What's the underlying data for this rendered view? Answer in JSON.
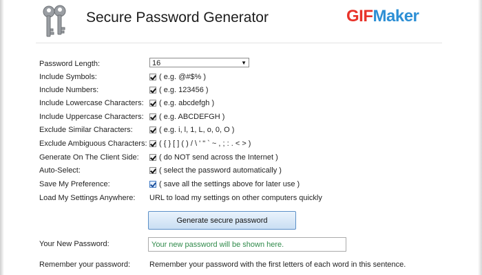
{
  "header": {
    "title": "Secure Password Generator",
    "brand_part1": "GIF",
    "brand_part2": "Maker",
    "logo_icon": "keys-icon"
  },
  "colors": {
    "brand_red": "#e8332a",
    "brand_blue": "#2d8fd5",
    "placeholder_green": "#2f8a4a",
    "button_border": "#5b8fc7"
  },
  "form": {
    "password_length": {
      "label": "Password Length:",
      "selected": "16"
    },
    "include_symbols": {
      "label": "Include Symbols:",
      "hint": "( e.g. @#$% )",
      "checked": true
    },
    "include_numbers": {
      "label": "Include Numbers:",
      "hint": "( e.g. 123456 )",
      "checked": true
    },
    "include_lowercase": {
      "label": "Include Lowercase Characters:",
      "hint": "( e.g. abcdefgh )",
      "checked": true
    },
    "include_uppercase": {
      "label": "Include Uppercase Characters:",
      "hint": "( e.g. ABCDEFGH )",
      "checked": true
    },
    "exclude_similar": {
      "label": "Exclude Similar Characters:",
      "hint": "( e.g. i, l, 1, L, o, 0, O )",
      "checked": true
    },
    "exclude_ambiguous": {
      "label": "Exclude Ambiguous Characters:",
      "hint": "( { } [ ] ( ) / \\ ' \" ` ~ , ; : . < > )",
      "checked": true
    },
    "generate_client_side": {
      "label": "Generate On The Client Side:",
      "hint": "( do NOT send across the Internet )",
      "checked": true
    },
    "auto_select": {
      "label": "Auto-Select:",
      "hint": "( select the password automatically )",
      "checked": true
    },
    "save_preference": {
      "label": "Save My Preference:",
      "hint": "( save all the settings above for later use )",
      "checked": true
    },
    "load_settings": {
      "label": "Load My Settings Anywhere:",
      "link": "URL to load my settings on other computers quickly"
    }
  },
  "generate_button": "Generate secure password",
  "new_password": {
    "label": "Your New Password:",
    "placeholder": "Your new password will be shown here."
  },
  "remember": {
    "label": "Remember your password:",
    "text": "Remember your password with the first letters of each word in this sentence."
  }
}
